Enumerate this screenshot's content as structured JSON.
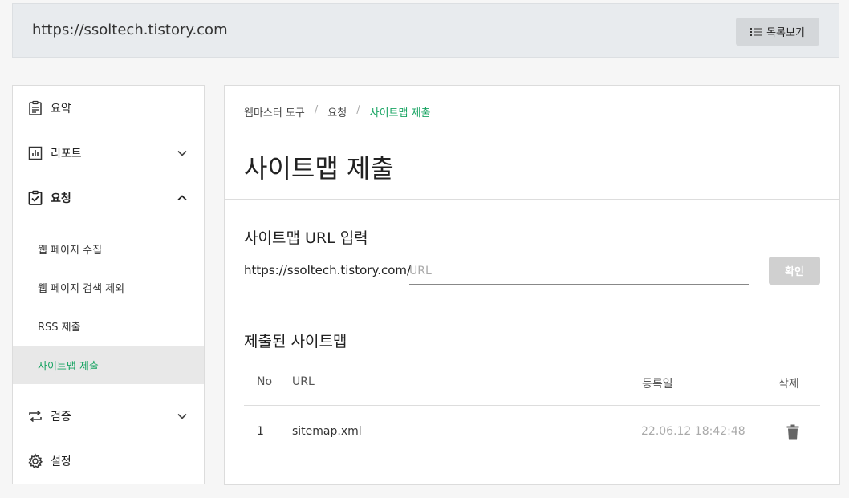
{
  "header": {
    "site_url": "https://ssoltech.tistory.com",
    "list_button_label": "목록보기"
  },
  "sidebar": {
    "items": [
      {
        "label": "요약",
        "icon": "clipboard-list-icon"
      },
      {
        "label": "리포트",
        "icon": "bar-chart-icon",
        "expanded": false
      },
      {
        "label": "요청",
        "icon": "clipboard-check-icon",
        "expanded": true
      },
      {
        "label": "검증",
        "icon": "repeat-icon",
        "expanded": false
      },
      {
        "label": "설정",
        "icon": "gear-icon"
      }
    ],
    "sub_items": [
      {
        "label": "웹 페이지 수집"
      },
      {
        "label": "웹 페이지 검색 제외"
      },
      {
        "label": "RSS 제출"
      },
      {
        "label": "사이트맵 제출",
        "active": true
      }
    ]
  },
  "main": {
    "breadcrumb": [
      "웹마스터 도구",
      "요청",
      "사이트맵 제출"
    ],
    "title": "사이트맵 제출",
    "input_section": {
      "title": "사이트맵 URL 입력",
      "url_prefix": "https://ssoltech.tistory.com/",
      "placeholder": "URL",
      "value": "",
      "confirm_label": "확인"
    },
    "submitted_section": {
      "title": "제출된 사이트맵",
      "columns": [
        "No",
        "URL",
        "등록일",
        "삭제"
      ],
      "rows": [
        {
          "no": "1",
          "url": "sitemap.xml",
          "date": "22.06.12 18:42:48"
        }
      ]
    }
  },
  "colors": {
    "accent": "#19a463",
    "topbar_bg": "#e8ebee",
    "active_bg": "#e8e8e8"
  }
}
